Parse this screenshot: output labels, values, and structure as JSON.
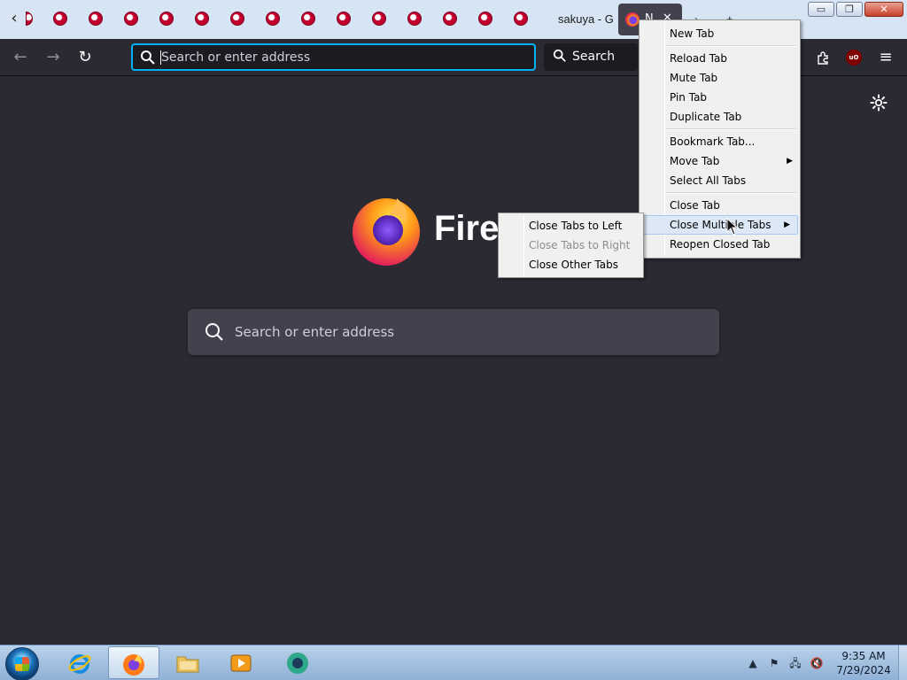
{
  "tabs": {
    "pinned_count": 14,
    "background_tab_title": "sakuya - G",
    "active_tab_title": "N"
  },
  "toolbar": {
    "url_placeholder": "Search or enter address",
    "search_label": "Search"
  },
  "newtab": {
    "wordmark": "Fire",
    "search_placeholder": "Search or enter address"
  },
  "tab_context_menu": {
    "items": [
      "New Tab",
      "Reload Tab",
      "Mute Tab",
      "Pin Tab",
      "Duplicate Tab",
      "Bookmark Tab...",
      "Move Tab",
      "Select All Tabs",
      "Close Tab",
      "Close Multiple Tabs",
      "Reopen Closed Tab"
    ]
  },
  "close_multiple_submenu": {
    "items": [
      "Close Tabs to Left",
      "Close Tabs to Right",
      "Close Other Tabs"
    ]
  },
  "taskbar": {
    "time": "9:35 AM",
    "date": "7/29/2024"
  },
  "colors": {
    "accent": "#00b3f4",
    "toolbar_bg": "#2b2a33",
    "content_bg": "#2b2a33"
  }
}
